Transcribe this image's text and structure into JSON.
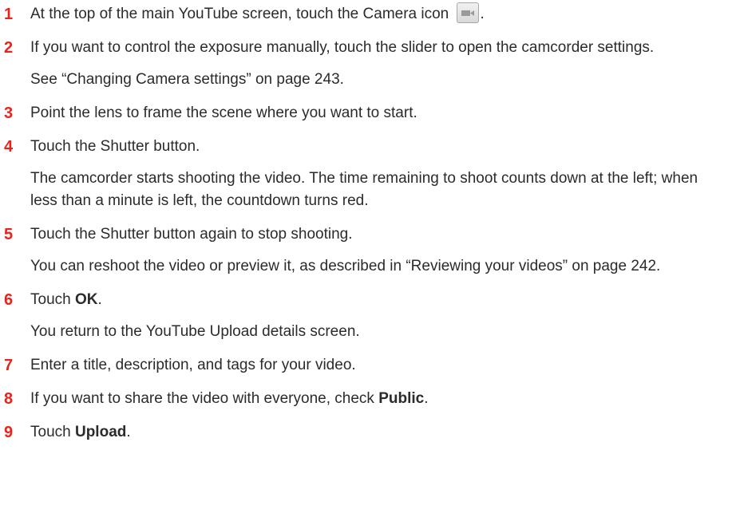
{
  "steps": [
    {
      "num": "1",
      "text_before": "At the top of the main YouTube screen, touch the Camera icon",
      "text_after": ".",
      "icon": "camera-icon"
    },
    {
      "num": "2",
      "text": "If you want to control the exposure manually, touch the slider to open the camcorder settings.",
      "note": "See “Changing Camera settings” on page 243."
    },
    {
      "num": "3",
      "text": "Point the lens to frame the scene where you want to start."
    },
    {
      "num": "4",
      "text": "Touch the Shutter button.",
      "note": "The camcorder starts shooting the video. The time remaining to shoot counts down at the left; when less than a minute is left, the countdown turns red."
    },
    {
      "num": "5",
      "text": "Touch the Shutter button again to stop shooting.",
      "note": "You can reshoot the video or preview it, as described in “Reviewing your videos” on page 242."
    },
    {
      "num": "6",
      "text_before": "Touch ",
      "bold": "OK",
      "text_after": ".",
      "note": "You return to the YouTube Upload details screen."
    },
    {
      "num": "7",
      "text": "Enter a title, description, and tags for your video."
    },
    {
      "num": "8",
      "text_before": "If you want to share the video with everyone, check ",
      "bold": "Public",
      "text_after": "."
    },
    {
      "num": "9",
      "text_before": "Touch ",
      "bold": "Upload",
      "text_after": "."
    }
  ],
  "colors": {
    "step_number": "#e8231c",
    "body_text": "#2b2b2b"
  }
}
